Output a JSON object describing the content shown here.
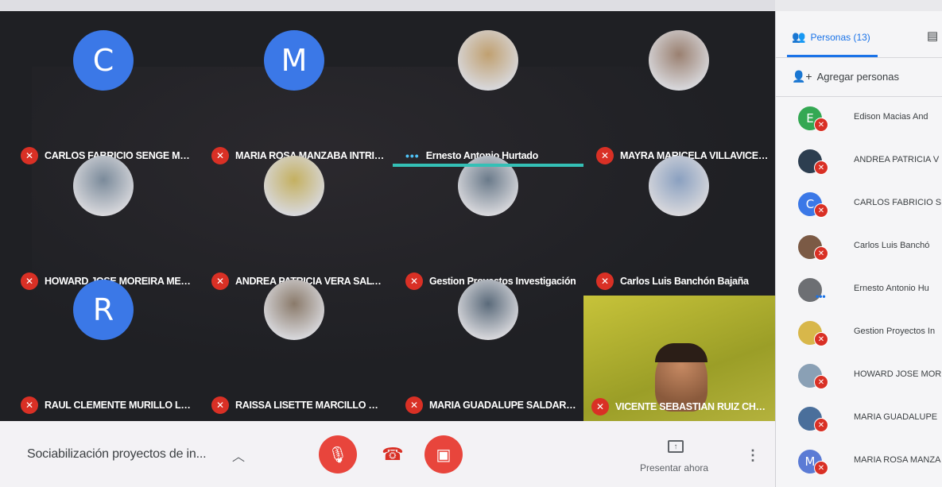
{
  "meeting": {
    "title": "Sociabilización proyectos de in...",
    "present_label": "Presentar ahora"
  },
  "tiles": [
    {
      "name": "CARLOS FABRICIO SENGE MOREI...",
      "avatar": "letter",
      "initial": "C",
      "muted": true
    },
    {
      "name": "MARIA ROSA MANZABA INTRIA...",
      "avatar": "letter",
      "initial": "M",
      "muted": true
    },
    {
      "name": "Ernesto Antonio Hurtado",
      "avatar": "photo",
      "muted": false,
      "speaking": true
    },
    {
      "name": "MAYRA MARICELA VILLAVICENC...",
      "avatar": "photo",
      "muted": true
    },
    {
      "name": "HOWARD JOSE MOREIRA MEND...",
      "avatar": "photo",
      "muted": true
    },
    {
      "name": "ANDREA PATRICIA VERA SALTOS",
      "avatar": "photo",
      "muted": true
    },
    {
      "name": "Gestion Proyectos Investigación",
      "avatar": "photo",
      "muted": true
    },
    {
      "name": "Carlos Luis Banchón Bajaña",
      "avatar": "photo",
      "muted": true
    },
    {
      "name": "RAUL CLEMENTE MURILLO LOOR",
      "avatar": "letter",
      "initial": "R",
      "muted": true
    },
    {
      "name": "RAISSA LISETTE MARCILLO MOL...",
      "avatar": "photo",
      "muted": true
    },
    {
      "name": "MARIA GUADALUPE SALDARRIA...",
      "avatar": "photo",
      "muted": true
    },
    {
      "name": "VICENTE SEBASTIAN RUIZ CHEV...",
      "avatar": "camera",
      "muted": true
    }
  ],
  "panel": {
    "people_tab": "Personas (13)",
    "add_people": "Agregar personas",
    "participants": [
      {
        "name": "Edison Macias And",
        "initial": "E",
        "color": "#34a853",
        "muted": true
      },
      {
        "name": "ANDREA PATRICIA V",
        "initial": "",
        "color": "#2d3e50",
        "muted": true
      },
      {
        "name": "CARLOS FABRICIO SI",
        "initial": "C",
        "color": "#3b78e7",
        "muted": true
      },
      {
        "name": "Carlos Luis Banchó",
        "initial": "",
        "color": "#7b5a45",
        "muted": true
      },
      {
        "name": "Ernesto Antonio Hu",
        "initial": "",
        "color": "#6d6f73",
        "muted": false
      },
      {
        "name": "Gestion Proyectos In",
        "initial": "",
        "color": "#d8b74a",
        "muted": true
      },
      {
        "name": "HOWARD JOSE MOR",
        "initial": "",
        "color": "#8aa0b5",
        "muted": true
      },
      {
        "name": "MARIA GUADALUPE",
        "initial": "",
        "color": "#4a6f9b",
        "muted": true
      },
      {
        "name": "MARIA ROSA MANZA",
        "initial": "M",
        "color": "#5b7bd5",
        "muted": true
      }
    ]
  },
  "colors": {
    "accent": "#1a73e8",
    "mute": "#d93025",
    "speaking": "#34c0b6"
  }
}
